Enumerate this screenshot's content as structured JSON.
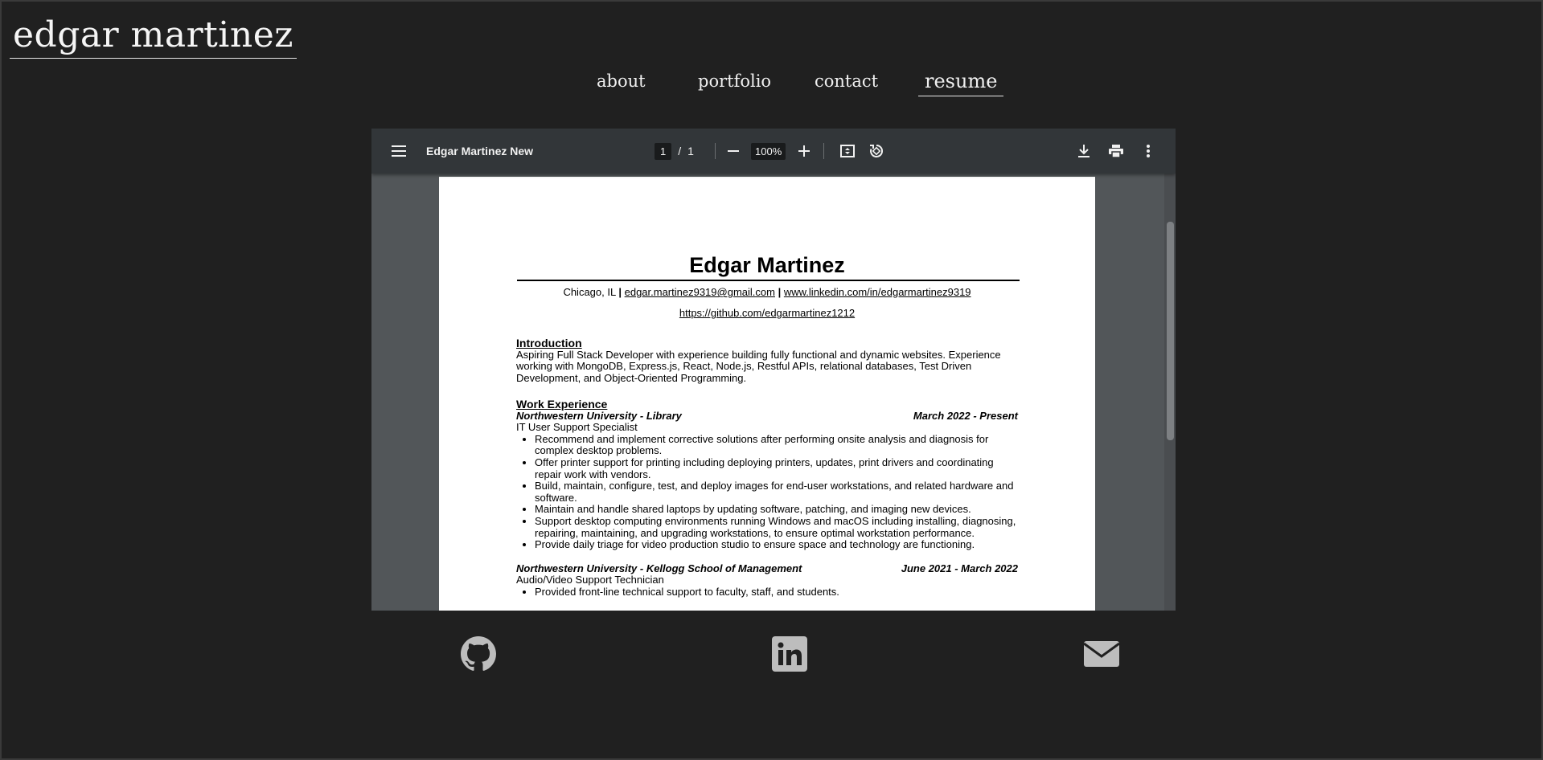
{
  "site": {
    "title": "edgar martinez"
  },
  "nav": {
    "items": [
      {
        "label": "about"
      },
      {
        "label": "portfolio"
      },
      {
        "label": "contact"
      },
      {
        "label": "resume"
      }
    ]
  },
  "viewer": {
    "doc_title": "Edgar Martinez New",
    "page_current": "1",
    "page_sep": "/",
    "page_total": "1",
    "zoom": "100%",
    "icons": [
      "menu-icon",
      "zoom-out-icon",
      "zoom-in-icon",
      "fit-page-icon",
      "rotate-icon",
      "download-icon",
      "print-icon",
      "more-icon"
    ]
  },
  "resume": {
    "name": "Edgar Martinez",
    "contact_location": "Chicago, IL",
    "contact_sep": "|",
    "email": "edgar.martinez9319@gmail.com",
    "linkedin": "www.linkedin.com/in/edgarmartinez9319",
    "github": "https://github.com/edgarmartinez1212",
    "intro_heading": "Introduction",
    "intro_text": "Aspiring Full Stack Developer with experience building fully functional and dynamic websites. Experience working with MongoDB, Express.js, React, Node.js, Restful APIs, relational databases, Test Driven Development, and Object-Oriented Programming.",
    "work_heading": "Work Experience",
    "jobs": [
      {
        "org": "Northwestern University - Library",
        "dates": "March 2022 - Present",
        "title": "IT User Support Specialist",
        "bullets": [
          "Recommend and implement corrective solutions after performing onsite analysis and diagnosis for complex desktop problems.",
          "Offer printer support for printing including deploying printers, updates, print drivers and coordinating repair work with vendors.",
          "Build, maintain, configure, test, and deploy images for end-user workstations, and related hardware and software.",
          "Maintain and handle shared laptops by updating software, patching, and imaging new devices.",
          "Support desktop computing environments running Windows and macOS including installing, diagnosing, repairing, maintaining, and upgrading workstations, to ensure optimal workstation performance.",
          "Provide daily triage for video production studio to ensure space and technology are functioning."
        ]
      },
      {
        "org": "Northwestern University - Kellogg School of Management",
        "dates": "June 2021 - March 2022",
        "title": "Audio/Video Support Technician",
        "bullets": [
          "Provided front-line technical support to faculty, staff, and students."
        ]
      }
    ]
  },
  "footer": {
    "icons": [
      "github-icon",
      "linkedin-icon",
      "email-icon"
    ]
  },
  "colors": {
    "background": "#202020",
    "toolbar": "#323639",
    "viewer_bg": "#525659",
    "icon_gray": "#bdbdbd"
  }
}
